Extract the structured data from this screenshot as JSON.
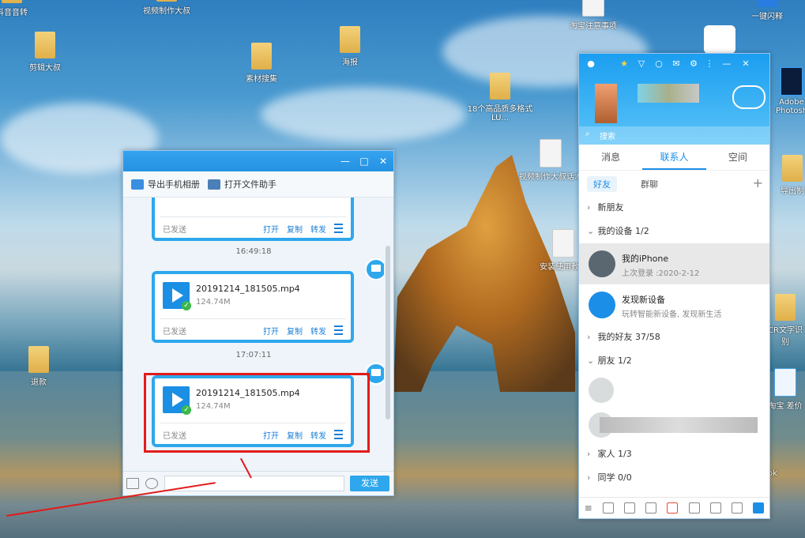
{
  "desktop": {
    "icons": [
      {
        "label": "抖音音转",
        "kind": "folder"
      },
      {
        "label": "视频制作大叔",
        "kind": "folder"
      },
      {
        "label": "淘宝注意事项",
        "kind": "doc"
      },
      {
        "label": "一键闪释",
        "kind": "app"
      },
      {
        "label": "剪辑大叔",
        "kind": "folder"
      },
      {
        "label": "素材搜集",
        "kind": "folder"
      },
      {
        "label": "海报",
        "kind": "folder"
      },
      {
        "label": "18个高品质多格式LU...",
        "kind": "folder"
      },
      {
        "label": "Adobe Photosh",
        "kind": "app"
      },
      {
        "label": "视频制作大叔话术",
        "kind": "doc"
      },
      {
        "label": "导出制",
        "kind": "folder"
      },
      {
        "label": "安装使用教程",
        "kind": "doc"
      },
      {
        "label": "退款",
        "kind": "folder"
      },
      {
        "label": "CR文字识别",
        "kind": "folder"
      },
      {
        "label": "淘宝 差价",
        "kind": "app"
      },
      {
        "label": "ok",
        "kind": "app"
      }
    ]
  },
  "chat": {
    "toolbar": {
      "export_album": "导出手机相册",
      "open_helper": "打开文件助手"
    },
    "messages": [
      {
        "time": "",
        "file": "",
        "size": "",
        "status": "已发送"
      },
      {
        "time": "16:49:18",
        "file": "20191214_181505.mp4",
        "size": "124.74M",
        "status": "已发送"
      },
      {
        "time": "17:07:11",
        "file": "20191214_181505.mp4",
        "size": "124.74M",
        "status": "已发送"
      }
    ],
    "actions": {
      "open": "打开",
      "copy": "复制",
      "forward": "转发"
    },
    "send_label": "发送"
  },
  "qq": {
    "search_placeholder": "搜索",
    "tabs": [
      "消息",
      "联系人",
      "空间"
    ],
    "subtabs": [
      "好友",
      "群聊"
    ],
    "groups": {
      "new_friends": "新朋友",
      "my_devices": "我的设备 1/2",
      "my_friends": "我的好友 37/58",
      "friends": "朋友 1/2",
      "family": "家人 1/3",
      "classmates": "同学 0/0"
    },
    "devices": [
      {
        "name": "我的iPhone",
        "sub": "上次登录 :2020-2-12"
      },
      {
        "name": "发现新设备",
        "sub": "玩转智能新设备, 发现新生活"
      }
    ],
    "colors": {
      "accent": "#1b9ef0",
      "highlight": "#e21b1b"
    }
  }
}
